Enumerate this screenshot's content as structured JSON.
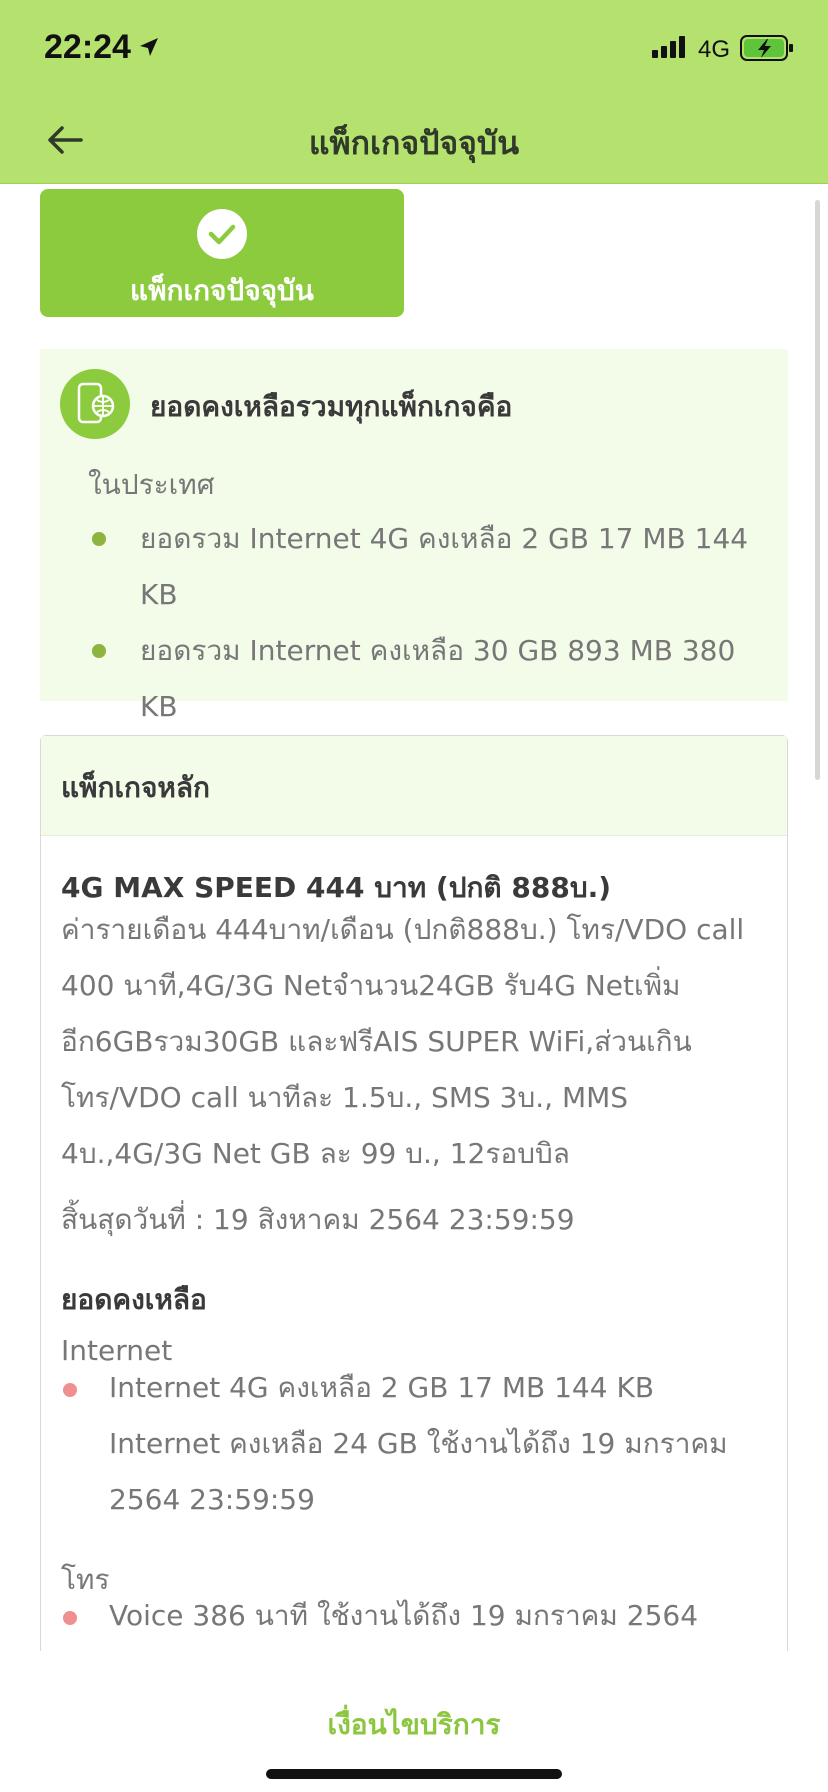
{
  "status_bar": {
    "time": "22:24",
    "network": "4G"
  },
  "nav": {
    "title": "แพ็กเกจปัจจุบัน"
  },
  "current_button": {
    "label": "แพ็กเกจปัจจุบัน"
  },
  "summary": {
    "title": "ยอดคงเหลือรวมทุกแพ็กเกจคือ",
    "region": "ในประเทศ",
    "items": [
      "ยอดรวม Internet 4G คงเหลือ 2 GB 17 MB 144 KB",
      "ยอดรวม Internet คงเหลือ 30 GB 893 MB 380 KB"
    ]
  },
  "main_package": {
    "header": "แพ็กเกจหลัก",
    "name": "4G MAX SPEED 444 บาท (ปกติ 888บ.)",
    "description": "ค่ารายเดือน 444บาท/เดือน (ปกติ888บ.) โทร/VDO call 400 นาที,4G/3G Netจำนวน24GB รับ4G Netเพิ่มอีก6GBรวม30GB และฟรีAIS SUPER WiFi,ส่วนเกินโทร/VDO call นาทีละ 1.5บ., SMS 3บ., MMS 4บ.,4G/3G Net GB ละ 99 บ., 12รอบบิล",
    "end_date": "สิ้นสุดวันที่ : 19 สิงหาคม 2564 23:59:59",
    "remaining_title": "ยอดคงเหลือ",
    "internet_label": "Internet",
    "internet_item": "Internet 4G คงเหลือ 2 GB 17 MB 144 KB Internet คงเหลือ 24 GB ใช้งานได้ถึง 19 มกราคม 2564 23:59:59",
    "voice_label": "โทร",
    "voice_item": "Voice 386 นาที ใช้งานได้ถึง 19 มกราคม 2564"
  },
  "footer": {
    "terms_label": "เงื่อนไขบริการ"
  },
  "colors": {
    "header_bg": "#b5e26e",
    "accent_green": "#8ccb3e",
    "card_bg": "#f3fbe9",
    "bullet_green": "#8cb43e",
    "bullet_red": "#ef8f8f",
    "link_green": "#8cc63f"
  }
}
